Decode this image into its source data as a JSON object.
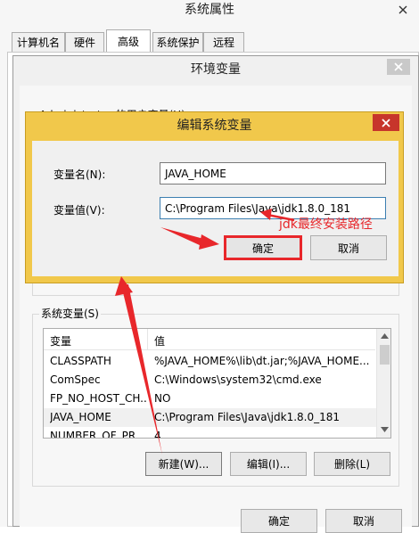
{
  "sysprops": {
    "title": "系统属性",
    "tabs": [
      "计算机名",
      "硬件",
      "高级",
      "系统保护",
      "远程"
    ]
  },
  "envvars": {
    "title": "环境变量",
    "user_section_label": "Administrator 的用户变量(U)",
    "system_section_label": "系统变量(S)",
    "columns": [
      "变量",
      "值"
    ],
    "rows": [
      {
        "name": "CLASSPATH",
        "value": "%JAVA_HOME%\\lib\\dt.jar;%JAVA_HOME..."
      },
      {
        "name": "ComSpec",
        "value": "C:\\Windows\\system32\\cmd.exe"
      },
      {
        "name": "FP_NO_HOST_CH...",
        "value": "NO"
      },
      {
        "name": "JAVA_HOME",
        "value": "C:\\Program Files\\Java\\jdk1.8.0_181"
      },
      {
        "name": "NUMBER_OF_PR...",
        "value": "4"
      }
    ],
    "new_label": "新建(W)...",
    "edit_label": "编辑(I)...",
    "delete_label": "删除(L)",
    "ok_label": "确定",
    "cancel_label": "取消"
  },
  "editdialog": {
    "title": "编辑系统变量",
    "name_label": "变量名(N):",
    "name_value": "JAVA_HOME",
    "value_label": "变量值(V):",
    "value_value": "C:\\Program Files\\Java\\jdk1.8.0_181",
    "ok_label": "确定",
    "cancel_label": "取消"
  },
  "annotation": {
    "text": "jdk最终安装路径",
    "color": "#e8272b"
  },
  "colors": {
    "highlight_border": "#e8272b",
    "dialog_frame": "#f1c84b",
    "close_red": "#c7352b"
  }
}
